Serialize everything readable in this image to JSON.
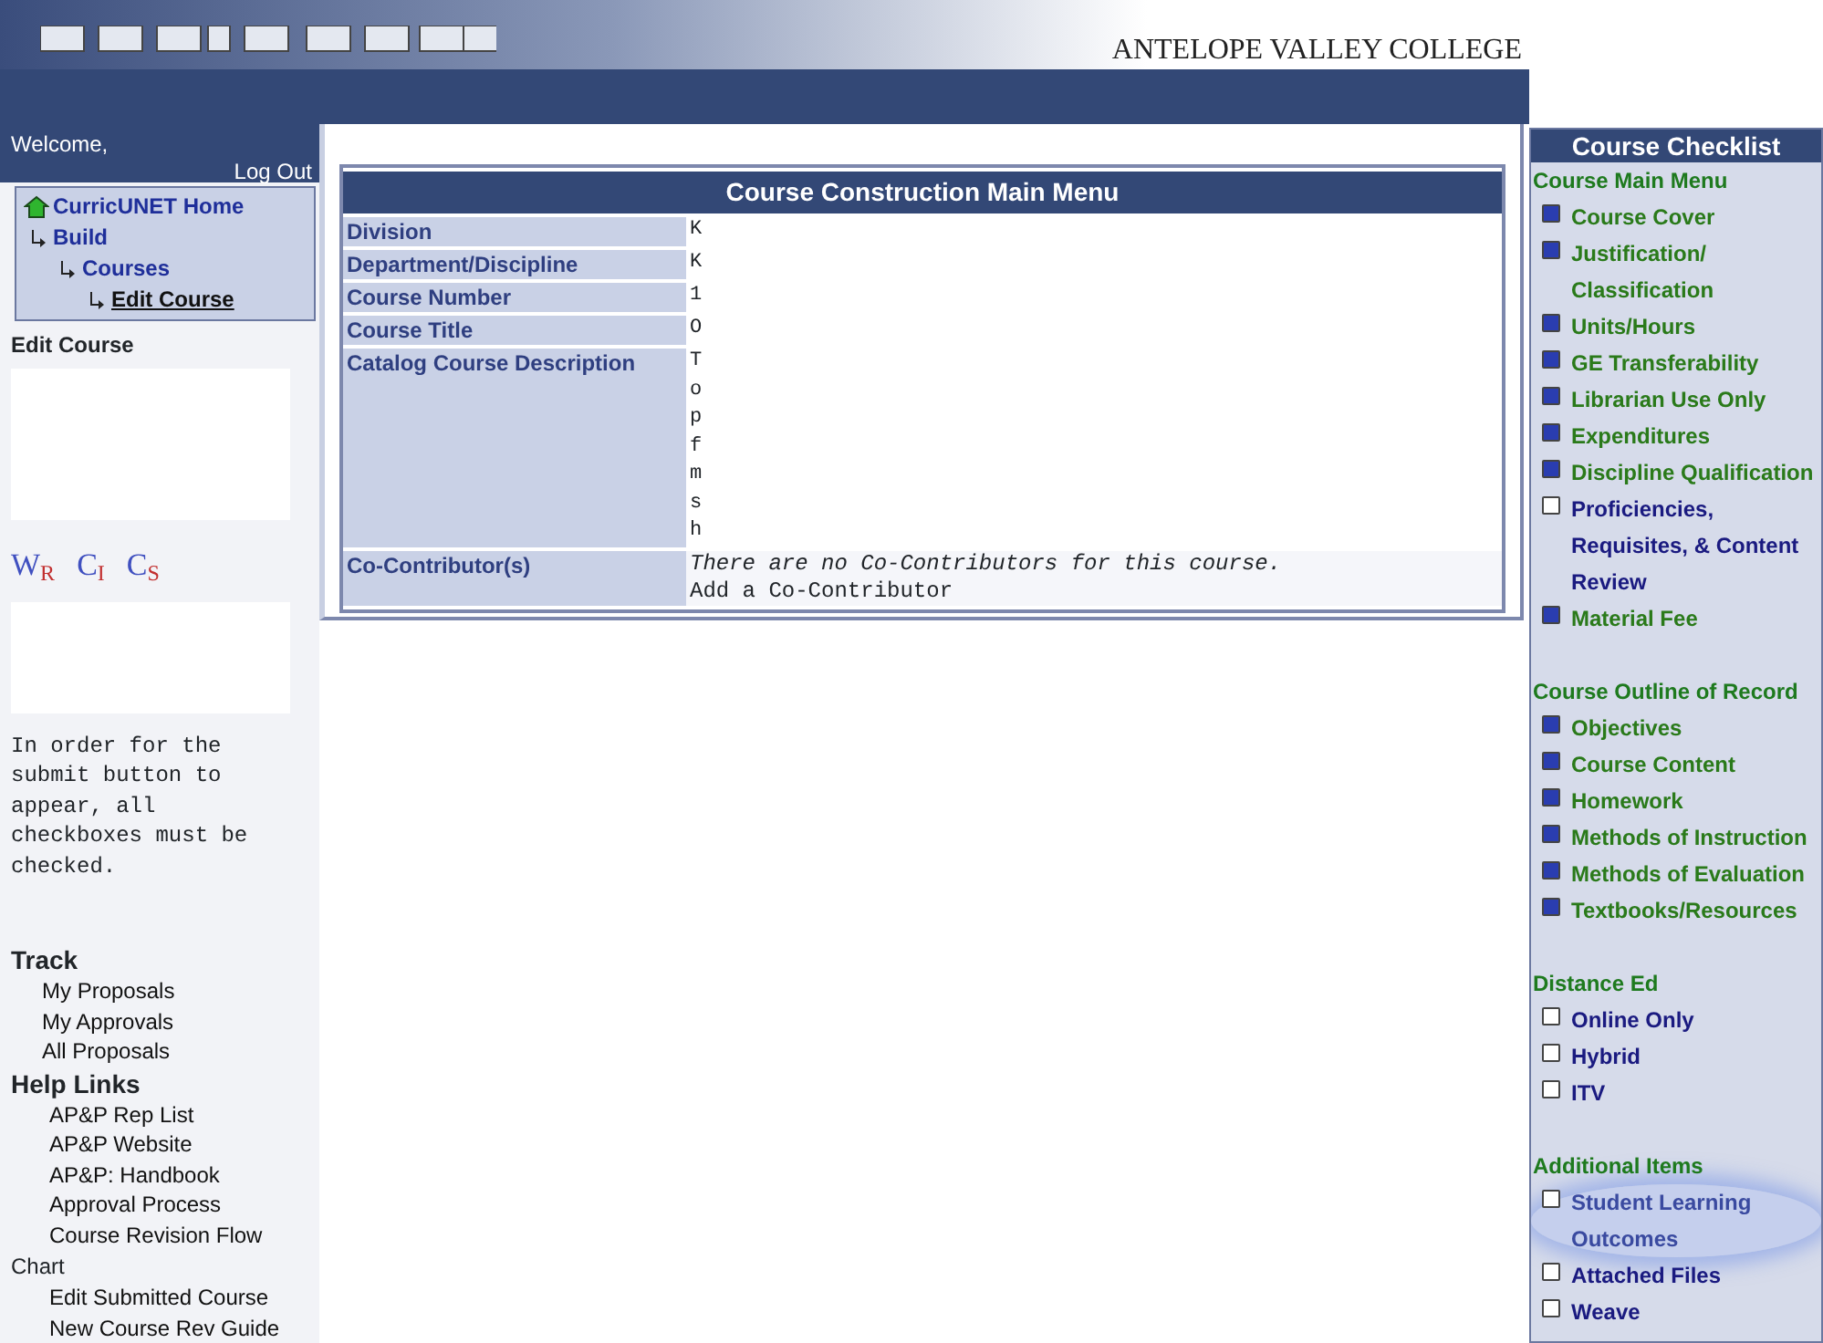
{
  "header": {
    "college": "ANTELOPE VALLEY COLLEGE"
  },
  "user_bar": {
    "welcome": "Welcome,",
    "logout": "Log Out"
  },
  "breadcrumb": [
    {
      "label": "CurricUNET Home",
      "kind": "home",
      "current": false
    },
    {
      "label": "Build",
      "kind": "branch",
      "current": false
    },
    {
      "label": "Courses",
      "kind": "branch",
      "current": false
    },
    {
      "label": "Edit Course",
      "kind": "branch",
      "current": true
    }
  ],
  "sidebar": {
    "heading": "Edit Course",
    "report_icons": [
      {
        "letter": "W",
        "sub": "R"
      },
      {
        "letter": "C",
        "sub": "I"
      },
      {
        "letter": "C",
        "sub": "S"
      }
    ],
    "note": "In order for the submit button to appear, all checkboxes must be checked.",
    "sections": [
      {
        "title": "Track",
        "kind": "major",
        "links": [
          "My Proposals",
          "My Approvals",
          "All Proposals"
        ]
      },
      {
        "title": "Help Links",
        "kind": "major",
        "links": [
          "AP&P Rep List",
          "AP&P Website",
          "AP&P: Handbook",
          "Approval Process",
          "Course Revision Flow"
        ]
      },
      {
        "title": "Chart",
        "kind": "minor",
        "links": [
          "Edit Submitted Course",
          "New Course Rev Guide"
        ]
      }
    ]
  },
  "main_menu": {
    "title": "Course Construction Main Menu",
    "rows": [
      {
        "label": "Division",
        "lines": [
          "K"
        ]
      },
      {
        "label": "Department/Discipline",
        "lines": [
          "K"
        ]
      },
      {
        "label": "Course Number",
        "lines": [
          "1"
        ]
      },
      {
        "label": "Course Title",
        "lines": [
          "O"
        ]
      },
      {
        "label": "Catalog Course Description",
        "lines": [
          "T",
          "o",
          "p",
          "f",
          "m",
          "s",
          "h"
        ]
      }
    ],
    "contributors": {
      "label": "Co-Contributor(s)",
      "note": "There are no Co-Contributors for this course.",
      "link": "Add a Co-Contributor"
    }
  },
  "checklist": {
    "title": "Course Checklist",
    "groups": [
      {
        "title": "Course Main Menu",
        "items": [
          {
            "label": "Course Cover",
            "checked": true,
            "highlighted": false
          },
          {
            "label": "Justification/ Classification",
            "checked": true,
            "highlighted": false
          },
          {
            "label": "Units/Hours",
            "checked": true,
            "highlighted": false
          },
          {
            "label": "GE Transferability",
            "checked": true,
            "highlighted": false
          },
          {
            "label": "Librarian Use Only",
            "checked": true,
            "highlighted": false
          },
          {
            "label": "Expenditures",
            "checked": true,
            "highlighted": false
          },
          {
            "label": "Discipline Qualification",
            "checked": true,
            "highlighted": false
          },
          {
            "label": "Proficiencies, Requisites, & Content Review",
            "checked": false,
            "highlighted": false
          },
          {
            "label": "Material Fee",
            "checked": true,
            "highlighted": false
          }
        ]
      },
      {
        "title": "Course Outline of Record",
        "items": [
          {
            "label": "Objectives",
            "checked": true,
            "highlighted": false
          },
          {
            "label": "Course Content",
            "checked": true,
            "highlighted": false
          },
          {
            "label": "Homework",
            "checked": true,
            "highlighted": false
          },
          {
            "label": "Methods of Instruction",
            "checked": true,
            "highlighted": false
          },
          {
            "label": "Methods of Evaluation",
            "checked": true,
            "highlighted": false
          },
          {
            "label": "Textbooks/Resources",
            "checked": true,
            "highlighted": false
          }
        ]
      },
      {
        "title": "Distance Ed",
        "items": [
          {
            "label": "Online Only",
            "checked": false,
            "highlighted": false
          },
          {
            "label": "Hybrid",
            "checked": false,
            "highlighted": false
          },
          {
            "label": "ITV",
            "checked": false,
            "highlighted": false
          }
        ]
      },
      {
        "title": "Additional Items",
        "items": [
          {
            "label": "Student Learning Outcomes",
            "checked": false,
            "highlighted": true
          },
          {
            "label": "Attached Files",
            "checked": false,
            "highlighted": false
          },
          {
            "label": "Weave",
            "checked": false,
            "highlighted": false
          }
        ]
      }
    ]
  }
}
